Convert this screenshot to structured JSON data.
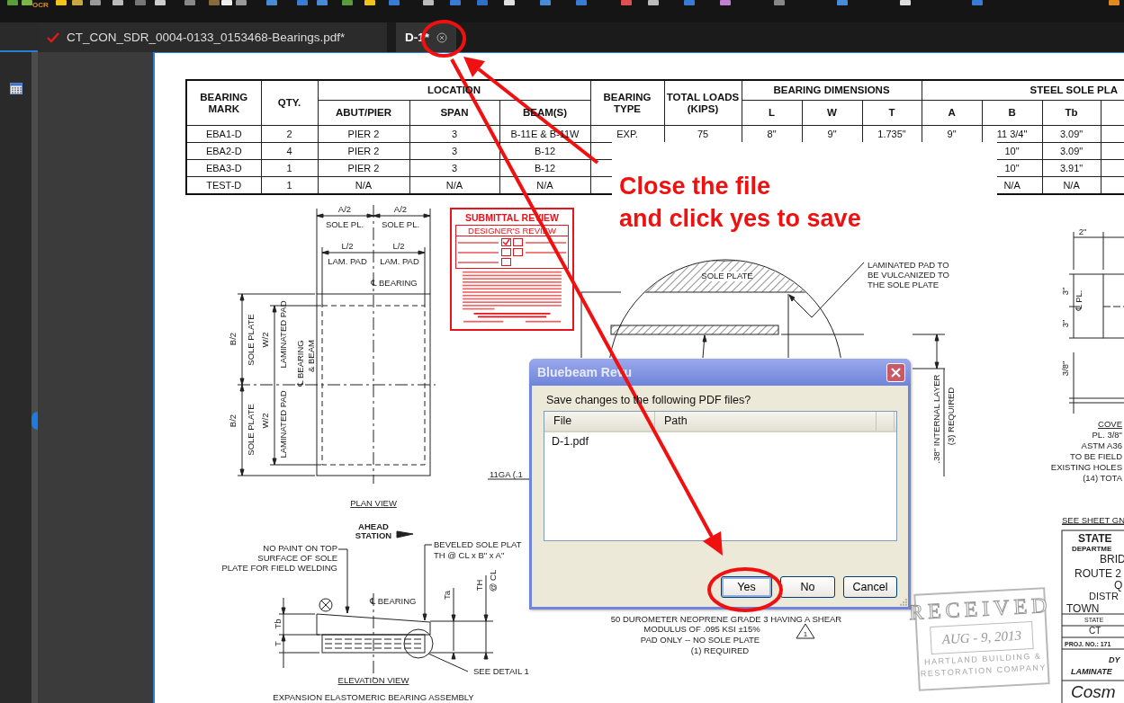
{
  "toolbar": {
    "ocr_label": "OCR"
  },
  "tabs": [
    {
      "label": "CT_CON_SDR_0004-0133_0153468-Bearings.pdf*",
      "selected": false
    },
    {
      "label": "D-1*",
      "selected": true
    }
  ],
  "table": {
    "groups": [
      {
        "label": "BEARING MARK"
      },
      {
        "label": "QTY."
      },
      {
        "label": "LOCATION",
        "columns": [
          "ABUT/PIER",
          "SPAN",
          "BEAM(S)"
        ]
      },
      {
        "label": "BEARING TYPE"
      },
      {
        "label": "TOTAL LOADS (KIPS)"
      },
      {
        "label": "BEARING DIMENSIONS",
        "columns": [
          "L",
          "W",
          "T"
        ]
      },
      {
        "label": "STEEL SOLE PLA",
        "columns": [
          "A",
          "B",
          "Tb"
        ]
      }
    ],
    "rows": [
      [
        "EBA1-D",
        "2",
        "PIER 2",
        "3",
        "B-11E & B-11W",
        "EXP.",
        "75",
        "8\"",
        "9\"",
        "1.735\"",
        "9\"",
        "11 3/4\"",
        "3.09\""
      ],
      [
        "EBA2-D",
        "4",
        "PIER 2",
        "3",
        "B-12",
        null,
        null,
        null,
        null,
        null,
        null,
        "10\"",
        "3.09\""
      ],
      [
        "EBA3-D",
        "1",
        "PIER 2",
        "3",
        "B-12",
        null,
        null,
        null,
        null,
        null,
        null,
        "10\"",
        "3.91\""
      ],
      [
        "TEST-D",
        "1",
        "N/A",
        "N/A",
        "N/A",
        null,
        null,
        null,
        null,
        null,
        null,
        "N/A",
        "N/A"
      ]
    ]
  },
  "drawing": {
    "labels": [
      "A/2",
      "A/2",
      "SOLE PL.",
      "SOLE PL.",
      "L/2",
      "L/2",
      "LAM. PAD",
      "LAM. PAD",
      "℄ BEARING",
      "B/2",
      "SOLE PLATE",
      "W/2",
      "LAMINATED PAD",
      "℄ BEARING",
      "& BEAM",
      "B/2",
      "SOLE PLATE",
      "W/2",
      "LAMINATED PAD",
      "PLAN VIEW",
      "AHEAD",
      "STATION",
      "NO PAINT ON TOP",
      "SURFACE OF SOLE",
      "PLATE FOR FIELD WELDING",
      "BEVELED SOLE PLAT",
      "TH @ CL x B\" x A\"",
      "℄ BEARING",
      "Ta",
      "TH",
      "@ CL",
      "Tb",
      "T",
      "SEE DETAIL 1",
      "ELEVATION VIEW",
      "EXPANSION ELASTOMERIC BEARING ASSEMBLY",
      "11GA (.1",
      "SOLE PLATE",
      "LAMINATED PAD TO",
      "BE VULCANIZED TO",
      "THE SOLE PLATE",
      ".38\" INTERNAL LAYER",
      "(3) REQUIRED",
      "50 DUROMETER NEOPRENE GRADE 3 HAVING A SHEAR",
      "MODULUS OF .095 KSI ±15%",
      "PAD ONLY -- NO SOLE PLATE",
      "(1) REQUIRED",
      "2\"",
      "3\"",
      "℄ PL.",
      "3\"",
      "3/8\"",
      "COVE",
      "PL. 3/8\"",
      "ASTM A36",
      "TO BE FIELD",
      "EXISTING HOLES",
      "(14) TOTA",
      "SEE SHEET GN"
    ],
    "revision_mark": "1"
  },
  "title_block": [
    "STATE",
    "DEPARTME",
    "BRID",
    "ROUTE 2",
    "Q",
    "DISTR",
    "TOWN",
    "STATE",
    "CT",
    "PROJ. NO.: 171",
    "DY",
    "LAMINATE",
    "Cosm"
  ],
  "review_stamp": {
    "title": "SUBMITTAL REVIEW",
    "subtitle": "DESIGNER'S REVIEW",
    "boxes": [
      {
        "checked": true
      },
      {
        "checked": false
      },
      {
        "checked": false
      },
      {
        "checked": false
      },
      {
        "checked": false
      }
    ]
  },
  "received_stamp": {
    "title": "RECEIVED",
    "date": "AUG - 9, 2013",
    "lines": [
      "HARTLAND BUILDING &",
      "RESTORATION COMPANY"
    ]
  },
  "annotation": {
    "lines": [
      "Close the file",
      "and click yes to save"
    ]
  },
  "dialog": {
    "title": "Bluebeam Revu",
    "message": "Save changes to the following PDF files?",
    "columns": [
      "File",
      "Path"
    ],
    "files": [
      "D-1.pdf"
    ],
    "buttons": [
      {
        "label": "Yes",
        "default": true
      },
      {
        "label": "No",
        "default": false
      },
      {
        "label": "Cancel",
        "default": false
      }
    ]
  }
}
